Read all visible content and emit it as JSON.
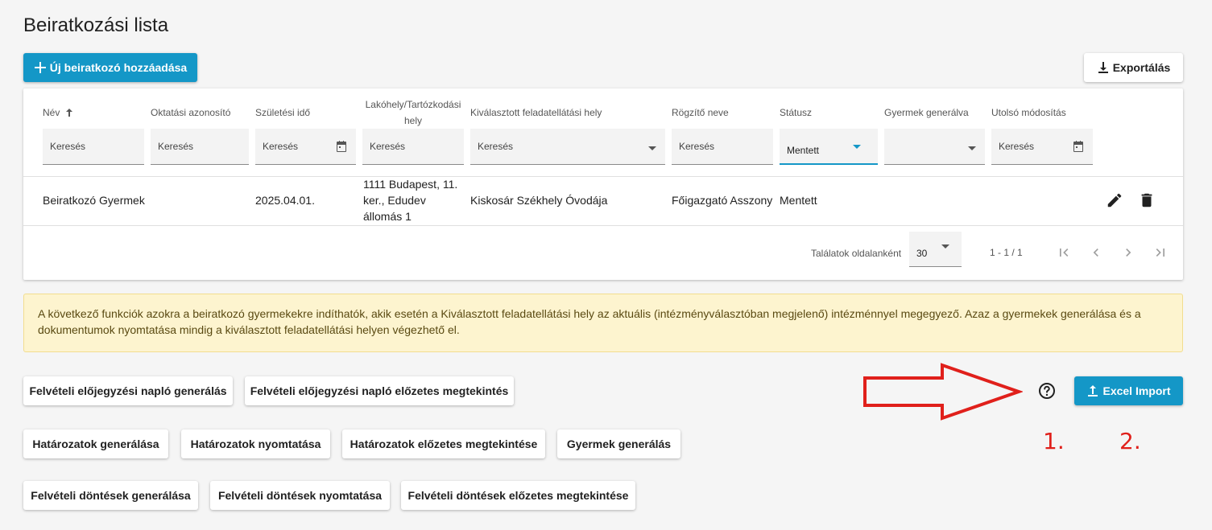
{
  "page": {
    "title": "Beiratkozási lista"
  },
  "toolbar": {
    "add_label": "Új beiratkozó hozzáadása",
    "export_label": "Exportálás"
  },
  "table": {
    "columns": [
      {
        "label": "Név",
        "sort": "asc"
      },
      {
        "label": "Oktatási azonosító"
      },
      {
        "label": "Születési idő"
      },
      {
        "label": "Lakóhely/Tartózkodási hely"
      },
      {
        "label": "Kiválasztott feladatellátási hely"
      },
      {
        "label": "Rögzítő neve"
      },
      {
        "label": "Státusz"
      },
      {
        "label": "Gyermek generálva"
      },
      {
        "label": "Utolsó módosítás"
      }
    ],
    "filter_placeholder": "Keresés",
    "status_filter_value": "Mentett",
    "rows": [
      {
        "name": "Beiratkozó Gyermek",
        "education_id": "",
        "birth_date": "2025.04.01.",
        "address": "1111 Budapest, 11. ker., Edudev állomás 1",
        "institution": "Kiskosár Székhely Óvodája",
        "recorder": "Főigazgató Asszony",
        "status": "Mentett",
        "generated": "",
        "last_modified": ""
      }
    ]
  },
  "pagination": {
    "per_page_label": "Találatok oldalanként",
    "per_page_value": "30",
    "range": "1 - 1 / 1"
  },
  "notice": {
    "text": "A következő funkciók azokra a beiratkozó gyermekekre indíthatók, akik esetén a Kiválasztott feladatellátási hely az aktuális (intézményválasztóban megjelenő) intézménnyel megegyező. Azaz a gyermekek generálása és a dokumentumok nyomtatása mindig a kiválasztott feladatellátási helyen végezhető el."
  },
  "actions": {
    "row1": [
      "Felvételi előjegyzési napló generálás",
      "Felvételi előjegyzési napló előzetes megtekintés"
    ],
    "row2": [
      "Határozatok generálása",
      "Határozatok nyomtatása",
      "Határozatok előzetes megtekintése",
      "Gyermek generálás"
    ],
    "row3": [
      "Felvételi döntések generálása",
      "Felvételi döntések nyomtatása",
      "Felvételi döntések előzetes megtekintése"
    ],
    "excel_import_label": "Excel Import"
  },
  "annotations": {
    "label_1": "1.",
    "label_2": "2."
  },
  "colors": {
    "primary": "#1497c7",
    "notice_bg": "#fdf4cf",
    "annotation": "#e0201b"
  },
  "icons": [
    "plus-icon",
    "download-icon",
    "sort-arrow-up-icon",
    "calendar-icon",
    "chevron-down-icon",
    "edit-icon",
    "delete-icon",
    "first-page-icon",
    "prev-page-icon",
    "next-page-icon",
    "last-page-icon",
    "help-icon",
    "upload-icon",
    "arrow-annotation-icon"
  ]
}
